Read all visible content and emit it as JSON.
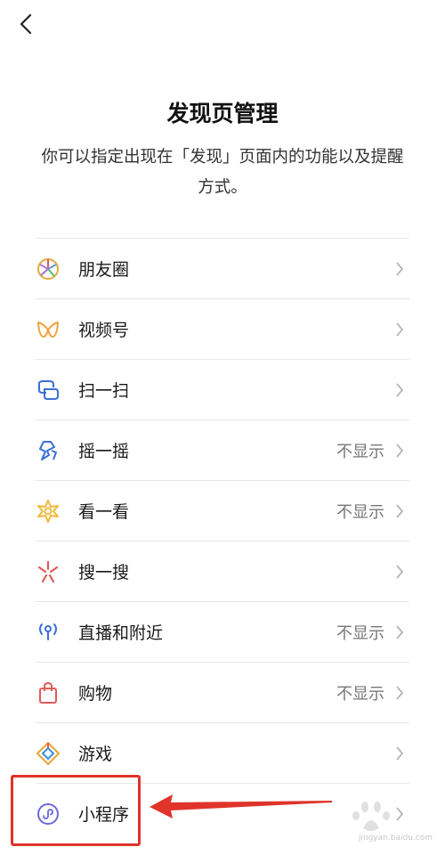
{
  "header": {
    "back_icon": "chevron-left-icon",
    "title": "发现页管理",
    "description": "你可以指定出现在「发现」页面内的功能以及提醒方式。"
  },
  "items": [
    {
      "label": "朋友圈",
      "status": "",
      "icon": "moments-icon"
    },
    {
      "label": "视频号",
      "status": "",
      "icon": "channels-icon"
    },
    {
      "label": "扫一扫",
      "status": "",
      "icon": "scan-icon"
    },
    {
      "label": "摇一摇",
      "status": "不显示",
      "icon": "shake-icon"
    },
    {
      "label": "看一看",
      "status": "不显示",
      "icon": "top-stories-icon"
    },
    {
      "label": "搜一搜",
      "status": "",
      "icon": "search-icon"
    },
    {
      "label": "直播和附近",
      "status": "不显示",
      "icon": "live-nearby-icon"
    },
    {
      "label": "购物",
      "status": "不显示",
      "icon": "shopping-bag-icon"
    },
    {
      "label": "游戏",
      "status": "",
      "icon": "game-icon"
    },
    {
      "label": "小程序",
      "status": "",
      "icon": "mini-program-icon"
    }
  ],
  "annotation": {
    "highlight_color": "#e0332a",
    "highlighted_item": "小程序"
  },
  "watermark": {
    "text": "jingyan.baidu.com"
  }
}
